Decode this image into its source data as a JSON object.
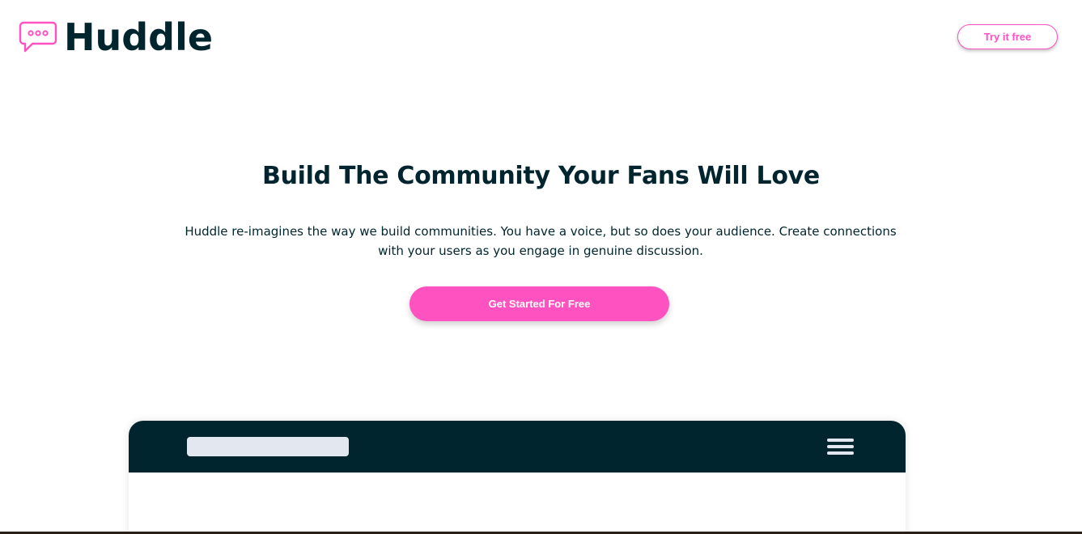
{
  "header": {
    "brand_name": "Huddle",
    "try_button_label": "Try it free",
    "logo_icon": "chat-bubble-icon"
  },
  "hero": {
    "title": "Build The Community Your Fans Will Love",
    "description": "Huddle re-imagines the way we build communities. You have a voice, but so does your audience. Create connections with your users as you engage in genuine discussion.",
    "cta_label": "Get Started For Free"
  },
  "mockup": {
    "menu_icon": "hamburger-menu-icon"
  },
  "colors": {
    "brand_dark": "#00252e",
    "accent_pink": "#ff52c1",
    "placeholder_gray": "#e3e8f0",
    "background": "#ffffff"
  }
}
